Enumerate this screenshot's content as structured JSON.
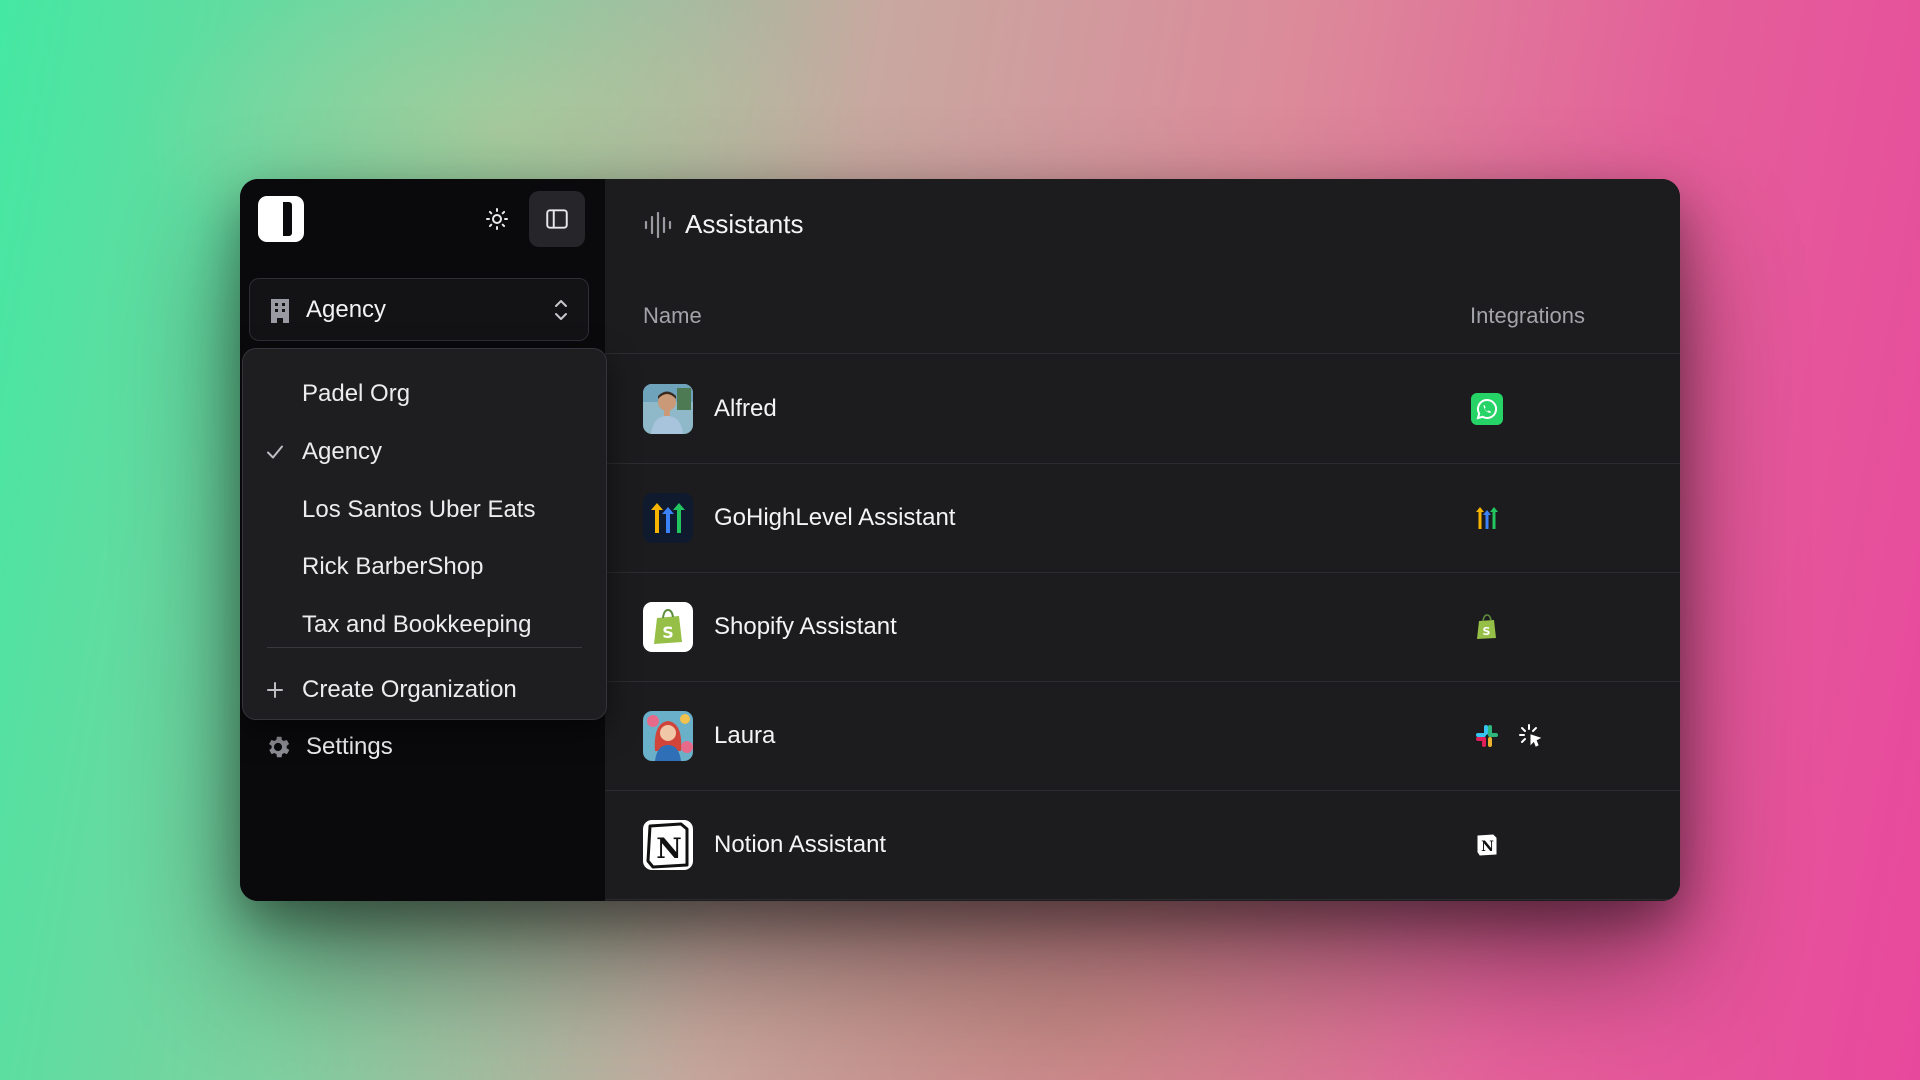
{
  "sidebar": {
    "logo": "app-logo",
    "theme_icon": "sun-icon",
    "panel_icon": "sidebar-toggle-icon",
    "org_select": {
      "icon": "building-icon",
      "current": "Agency",
      "chevron": "chevrons-up-down-icon"
    },
    "dropdown": {
      "items": [
        {
          "label": "Padel Org",
          "selected": false
        },
        {
          "label": "Agency",
          "selected": true
        },
        {
          "label": "Los Santos Uber Eats",
          "selected": false
        },
        {
          "label": "Rick BarberShop",
          "selected": false
        },
        {
          "label": "Tax and Bookkeeping",
          "selected": false
        }
      ],
      "create_label": "Create Organization"
    },
    "settings_label": "Settings"
  },
  "main": {
    "header": {
      "icon": "audio-waveform-icon",
      "title": "Assistants"
    },
    "columns": {
      "name": "Name",
      "integrations": "Integrations"
    },
    "rows": [
      {
        "name": "Alfred",
        "avatar": "alfred-avatar",
        "integrations": [
          "whatsapp-icon"
        ]
      },
      {
        "name": "GoHighLevel Assistant",
        "avatar": "gohighlevel-avatar",
        "integrations": [
          "gohighlevel-icon"
        ]
      },
      {
        "name": "Shopify Assistant",
        "avatar": "shopify-avatar",
        "integrations": [
          "shopify-icon"
        ]
      },
      {
        "name": "Laura",
        "avatar": "laura-avatar",
        "integrations": [
          "slack-icon",
          "loading-cursor-icon"
        ]
      },
      {
        "name": "Notion Assistant",
        "avatar": "notion-avatar",
        "integrations": [
          "notion-icon"
        ]
      }
    ]
  },
  "colors": {
    "whatsapp": "#25d366",
    "shopify": "#95bf47",
    "sidebar_bg": "#0a0a0c",
    "main_bg": "#1c1c1e"
  }
}
